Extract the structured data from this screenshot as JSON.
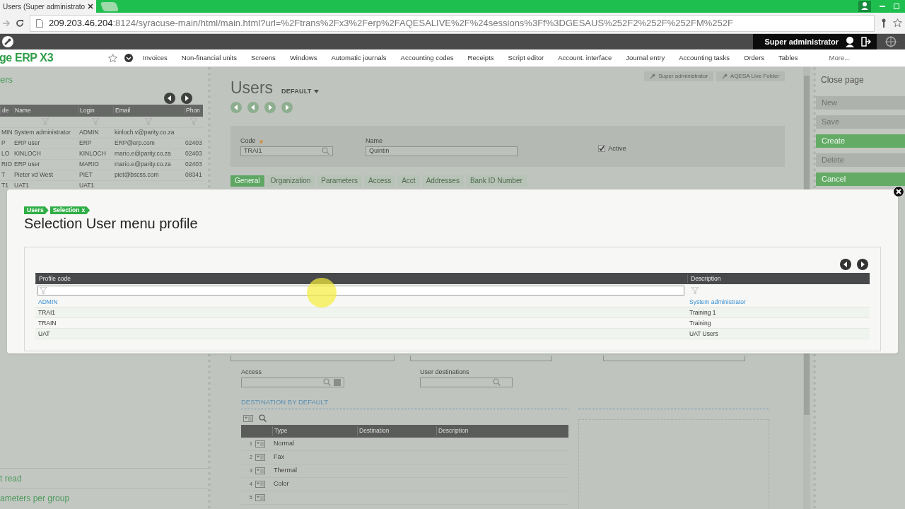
{
  "browser": {
    "tab_title": "Users (Super administrato",
    "url_host": "209.203.46.204",
    "url_rest": ":8124/syracuse-main/html/main.html?url=%2Ftrans%2Fx3%2Ferp%2FAQESALIVE%2F%24sessions%3Ff%3DGESAUS%252F2%252F%252FM%252F"
  },
  "app_bar": {
    "user": "Super administrator"
  },
  "menu": {
    "logo": "ge ERP X3",
    "items": [
      "Invoices",
      "Non-financial units",
      "Screens",
      "Windows",
      "Automatic journals",
      "Accounting codes",
      "Receipts",
      "Script editor",
      "Account. interface",
      "Journal entry",
      "Accounting tasks",
      "Orders",
      "Tables",
      "More..."
    ]
  },
  "left_panel": {
    "title": "ers",
    "columns": [
      "de",
      "Name",
      "Login",
      "Email",
      "Phon"
    ],
    "rows": [
      [
        "MIN",
        "System administrator",
        "ADMIN",
        "kinloch.v@parity.co.za",
        ""
      ],
      [
        "P",
        "ERP user",
        "ERP",
        "ERP@erp.com",
        "02403"
      ],
      [
        "LO",
        "KINLOCH",
        "KINLOCH",
        "mario.e@parity.co.za",
        "02403"
      ],
      [
        "RIO",
        "ERP user",
        "MARIO",
        "mario.e@parity.co.za",
        "02403"
      ],
      [
        "T",
        "Pieter vd West",
        "PIET",
        "piet@bscss.com",
        "08341"
      ],
      [
        "T1",
        "UAT1",
        "UAT1",
        "",
        ""
      ]
    ],
    "links": [
      "t read",
      "ameters per group"
    ]
  },
  "main": {
    "title": "Users",
    "variant": "DEFAULT",
    "badges": [
      "Super administrator",
      "AQESA Live Folder"
    ],
    "code": {
      "label": "Code",
      "value": "TRAI1"
    },
    "name": {
      "label": "Name",
      "value": "Quintin"
    },
    "active": {
      "label": "Active",
      "checked": true
    },
    "tabs": [
      {
        "label": "General",
        "selected": true
      },
      {
        "label": "Organization",
        "selected": false
      },
      {
        "label": "Parameters",
        "selected": false
      },
      {
        "label": "Access",
        "selected": false
      },
      {
        "label": "Acct",
        "selected": false
      },
      {
        "label": "Addresses",
        "selected": false
      },
      {
        "label": "Bank ID Number",
        "selected": false
      }
    ],
    "access_label": "Access",
    "destinations_label": "User destinations",
    "section_title": "DESTINATION BY DEFAULT",
    "table": {
      "columns": [
        "Type",
        "Destination",
        "Description"
      ],
      "rows": [
        {
          "number": "1",
          "type": "Normal"
        },
        {
          "number": "2",
          "type": "Fax"
        },
        {
          "number": "3",
          "type": "Thermal"
        },
        {
          "number": "4",
          "type": "Color"
        },
        {
          "number": "5",
          "type": ""
        }
      ]
    }
  },
  "right_panel": {
    "close": "Close page",
    "actions": [
      {
        "label": "New",
        "enabled": false
      },
      {
        "label": "Save",
        "enabled": false
      },
      {
        "label": "Create",
        "enabled": true
      },
      {
        "label": "Delete",
        "enabled": false
      },
      {
        "label": "Cancel",
        "enabled": true
      }
    ]
  },
  "modal": {
    "breadcrumb": [
      "Users",
      "Selection"
    ],
    "breadcrumb_close": "x",
    "title": "Selection User menu profile",
    "columns": [
      "Profile code",
      "Description"
    ],
    "rows": [
      {
        "code": "ADMIN",
        "description": "System administrator",
        "selected": true
      },
      {
        "code": "TRAI1",
        "description": "Training 1",
        "selected": false
      },
      {
        "code": "TRAIN",
        "description": "Training",
        "selected": false
      },
      {
        "code": "UAT",
        "description": "UAT Users",
        "selected": false
      }
    ]
  }
}
